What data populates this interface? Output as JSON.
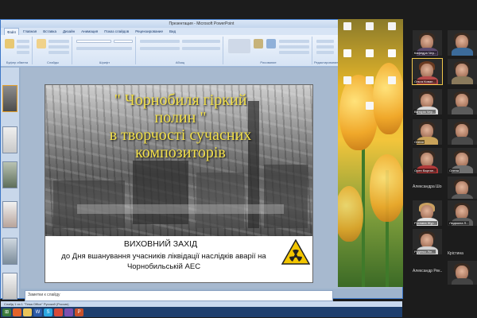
{
  "window": {
    "title": "Презентация - Microsoft PowerPoint",
    "ribbon_tabs": [
      "Файл",
      "Главная",
      "Вставка",
      "Дизайн",
      "Анимация",
      "Показ слайдов",
      "Рецензирование",
      "Вид"
    ],
    "ribbon_groups": [
      "Буфер обмена",
      "Слайды",
      "Шрифт",
      "Абзац",
      "Рисование",
      "Редактирование"
    ]
  },
  "slide": {
    "title": "\" Чорнобиля гіркий\n полин \"\n в творчості сучасних\n композиторів",
    "caption_heading": "ВИХОВНИЙ ЗАХІД",
    "caption_text": "до Дня вшанування учасників ліквідації наслідків аварії на Чорнобильській АЕС"
  },
  "notes": {
    "placeholder": "Заметки к слайду"
  },
  "status_bar": {
    "text": "Слайд 1 из 1   \"Тема Office\"   Русский (Россия)"
  },
  "taskbar": {
    "icons": [
      "start-icon",
      "firefox-icon",
      "folder-icon",
      "word-icon",
      "skype-icon",
      "chrome-icon",
      "viber-icon",
      "powerpoint-icon"
    ]
  },
  "participants": [
    {
      "name": "Кафедра Чер...",
      "active": false
    },
    {
      "name": "",
      "active": false
    },
    {
      "name": "Ольга Ковал...",
      "active": true
    },
    {
      "name": "",
      "active": false
    },
    {
      "name": "Вікторія Чер...",
      "active": false
    },
    {
      "name": "",
      "active": false
    },
    {
      "name": "Олеся",
      "active": false
    },
    {
      "name": "",
      "active": false
    },
    {
      "name": "Ореп Вартан...",
      "active": false
    },
    {
      "name": "Олена",
      "active": false
    },
    {
      "name": "Александра Шо...",
      "active": false
    },
    {
      "name": "",
      "active": false
    },
    {
      "name": "Руслана Жур...",
      "active": false
    },
    {
      "name": "Людмила Л...",
      "active": false
    },
    {
      "name": "Руденко Лін...",
      "active": false
    },
    {
      "name": "Крістина",
      "active": false
    },
    {
      "name": "Александр Рек...",
      "active": false
    },
    {
      "name": "",
      "active": false
    }
  ],
  "colors": {
    "title_yellow": "#f2e04a",
    "ribbon_blue": "#d7e4f5",
    "taskbar": "#1e3f6e"
  }
}
